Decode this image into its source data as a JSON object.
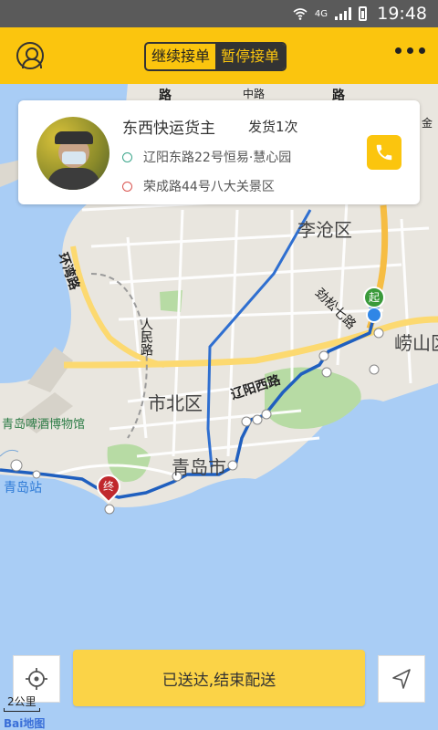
{
  "status_bar": {
    "network": "4G",
    "time": "19:48"
  },
  "header": {
    "toggle": {
      "continue_label": "继续接单",
      "pause_label": "暂停接单",
      "active": "pause"
    }
  },
  "card": {
    "sender_name": "东西快运货主",
    "ship_count": "发货1次",
    "from_address": "辽阳东路22号恒易·慧心园",
    "to_address": "荣成路44号八大关景区"
  },
  "map": {
    "labels": {
      "licang": "李沧区",
      "laoshan": "崂山区",
      "shibei": "市北区",
      "qingdao_city": "青岛市",
      "qingdao_station": "青岛站",
      "beer_museum": "青岛啤酒博物馆",
      "huanwan_road": "环湾路",
      "renmin_road": "人民路",
      "liaoyang_west": "辽阳西路",
      "jinsong_7": "劲松七路",
      "road_a": "路",
      "road_b": "路",
      "road_c": "中路",
      "jin": "金"
    },
    "start_marker": "起",
    "end_marker": "终",
    "scale": "2公里",
    "logo": "Bai地图",
    "colors": {
      "route": "#1f5fbf",
      "water": "#a9cdf5",
      "green": "#b7dba4",
      "major_road": "#fcd970"
    }
  },
  "actions": {
    "deliver_label": "已送达,结束配送"
  }
}
